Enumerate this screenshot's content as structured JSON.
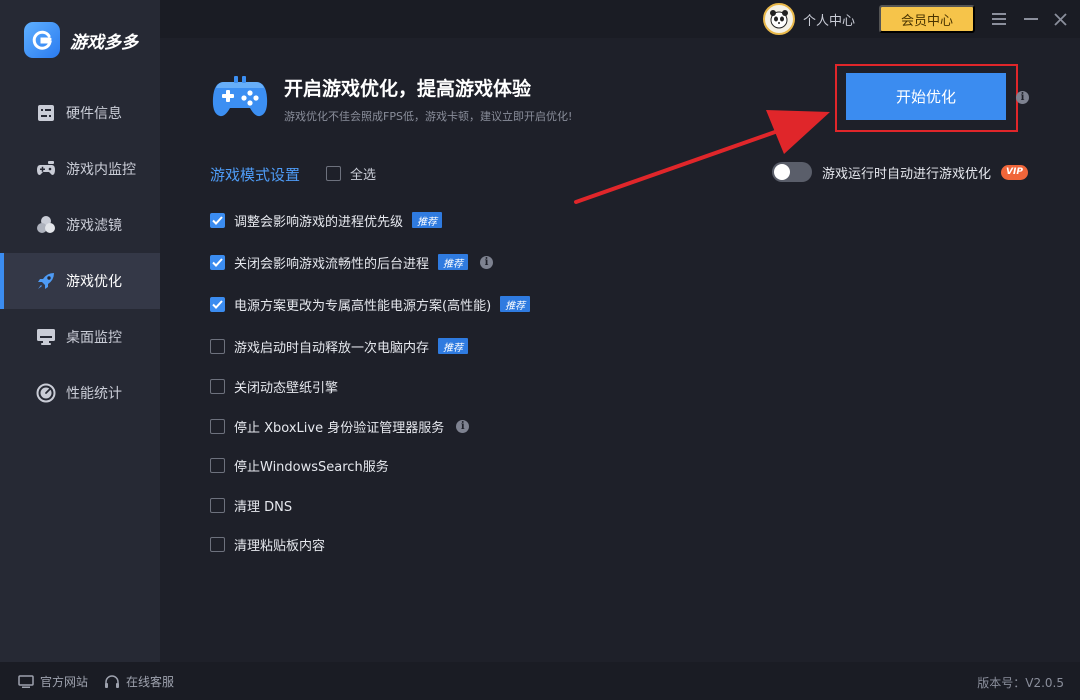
{
  "app": {
    "name": "游戏多多"
  },
  "sidebar": {
    "items": [
      {
        "label": "硬件信息",
        "icon": "hardware-icon",
        "active": false
      },
      {
        "label": "游戏内监控",
        "icon": "gamepad-monitor-icon",
        "active": false
      },
      {
        "label": "游戏滤镜",
        "icon": "filter-icon",
        "active": false
      },
      {
        "label": "游戏优化",
        "icon": "rocket-icon",
        "active": true
      },
      {
        "label": "桌面监控",
        "icon": "monitor-icon",
        "active": false
      },
      {
        "label": "性能统计",
        "icon": "gauge-icon",
        "active": false
      }
    ]
  },
  "topbar": {
    "user_center": "个人中心",
    "vip_center": "会员中心"
  },
  "main": {
    "headline": "开启游戏优化，提高游戏体验",
    "subline": "游戏优化不佳会照成FPS低，游戏卡顿，建议立即开启优化!",
    "start_button": "开始优化",
    "mode_title": "游戏模式设置",
    "select_all": "全选",
    "auto_toggle_label": "游戏运行时自动进行游戏优化",
    "auto_toggle_on": false,
    "vip_badge": "VIP",
    "recommend_tag": "推荐",
    "options": [
      {
        "label": "调整会影响游戏的进程优先级",
        "checked": true,
        "recommend": true,
        "info": false
      },
      {
        "label": "关闭会影响游戏流畅性的后台进程",
        "checked": true,
        "recommend": true,
        "info": true
      },
      {
        "label": "电源方案更改为专属高性能电源方案(高性能)",
        "checked": true,
        "recommend": true,
        "info": false
      },
      {
        "label": "游戏启动时自动释放一次电脑内存",
        "checked": false,
        "recommend": true,
        "info": false
      },
      {
        "label": "关闭动态壁纸引擎",
        "checked": false,
        "recommend": false,
        "info": false
      },
      {
        "label": "停止 XboxLive 身份验证管理器服务",
        "checked": false,
        "recommend": false,
        "info": true
      },
      {
        "label": "停止WindowsSearch服务",
        "checked": false,
        "recommend": false,
        "info": false
      },
      {
        "label": "清理 DNS",
        "checked": false,
        "recommend": false,
        "info": false
      },
      {
        "label": "清理粘贴板内容",
        "checked": false,
        "recommend": false,
        "info": false
      }
    ]
  },
  "footer": {
    "website": "官方网站",
    "support": "在线客服",
    "version": "版本号：V2.0.5"
  },
  "colors": {
    "accent": "#3b8cf0",
    "vip_gold": "#f6c44a",
    "highlight_red": "#e0262a",
    "vip_badge": "#f0663a"
  }
}
